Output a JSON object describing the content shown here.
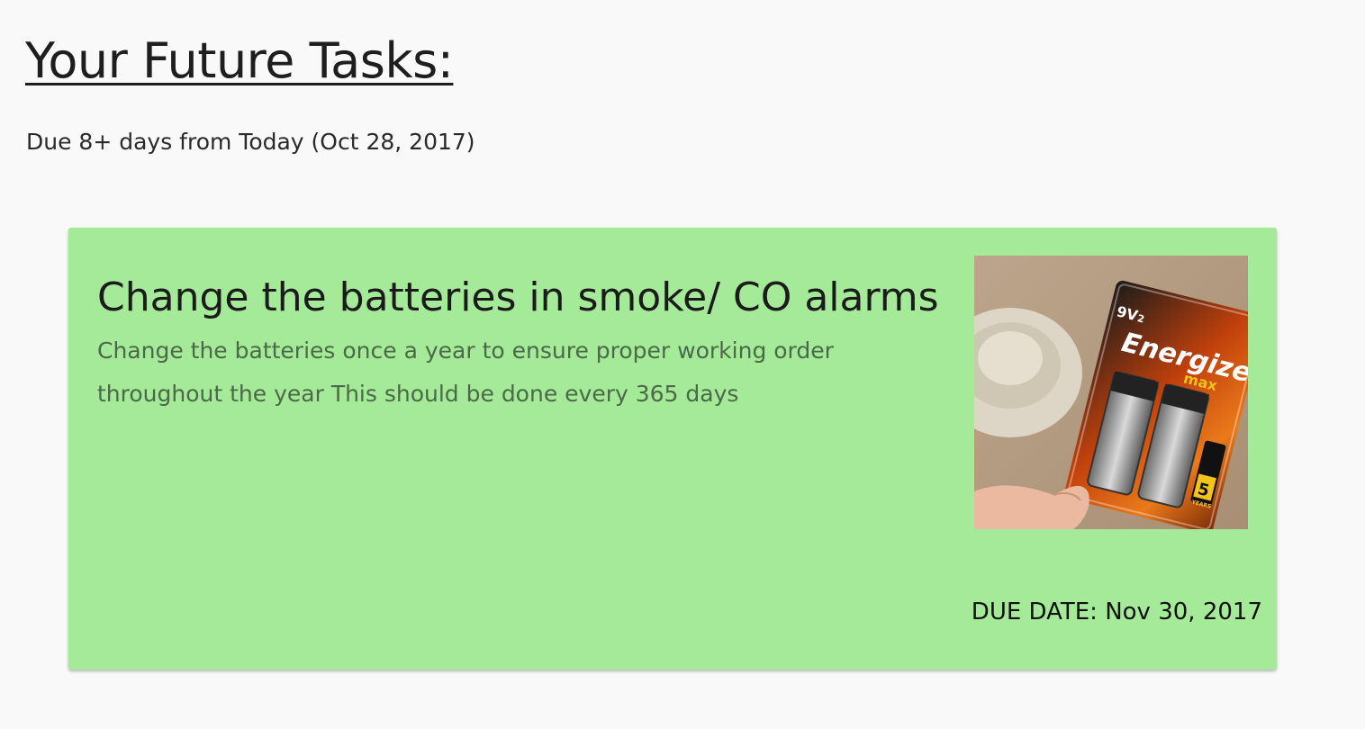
{
  "header": {
    "title": "Your Future Tasks:",
    "subtitle": "Due 8+ days from Today (Oct 28, 2017)"
  },
  "task": {
    "title": "Change the batteries in smoke/ CO alarms",
    "description": "Change the batteries once a year to ensure proper working order throughout the year This should be done every 365 days",
    "due_date": "DUE DATE: Nov 30, 2017",
    "card_color": "#a5ea99",
    "image": {
      "label_voltage": "9V",
      "label_count": "2",
      "brand": "Energizer",
      "sub_brand": "max",
      "years_badge": "5",
      "years_badge_text": "YEARS"
    }
  }
}
